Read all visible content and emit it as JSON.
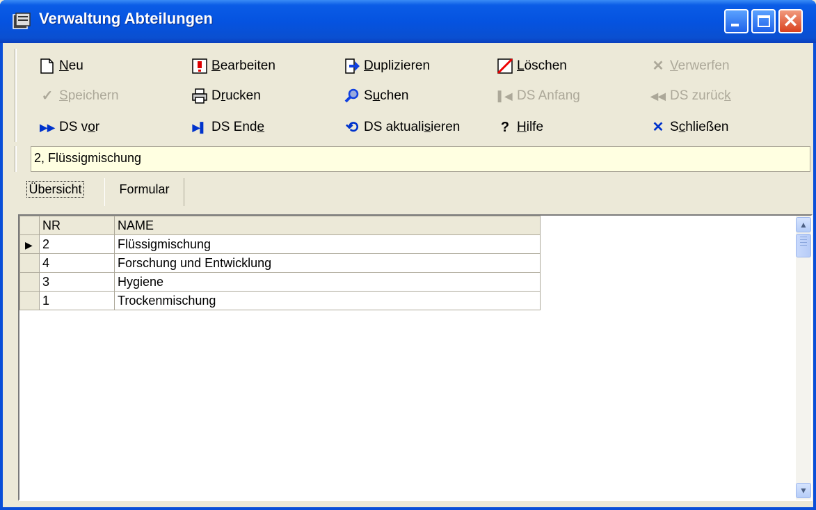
{
  "window": {
    "title": "Verwaltung Abteilungen"
  },
  "toolbar": {
    "neu": "Neu",
    "neu_u": "N",
    "neu_rest": "eu",
    "bearbeiten_u": "B",
    "bearbeiten_rest": "earbeiten",
    "duplizieren_u": "D",
    "duplizieren_rest": "uplizieren",
    "loeschen_u": "L",
    "loeschen_rest": "öschen",
    "verwerfen_u": "V",
    "verwerfen_rest": "erwerfen",
    "speichern_u": "S",
    "speichern_rest": "peichern",
    "drucken_a": "D",
    "drucken_u": "r",
    "drucken_b": "ucken",
    "suchen_a": "S",
    "suchen_u": "u",
    "suchen_b": "chen",
    "ds_anfang": "DS Anfang",
    "ds_zurueck_a": "DS zurüc",
    "ds_zurueck_u": "k",
    "ds_vor_a": "DS v",
    "ds_vor_u": "o",
    "ds_vor_b": "r",
    "ds_ende_a": "DS End",
    "ds_ende_u": "e",
    "ds_akt_a": "DS aktuali",
    "ds_akt_u": "s",
    "ds_akt_b": "ieren",
    "hilfe_u": "H",
    "hilfe_rest": "ilfe",
    "schliessen_a": "S",
    "schliessen_u": "c",
    "schliessen_b": "hließen"
  },
  "record_bar": {
    "value": "2, Flüssigmischung"
  },
  "tabs": [
    {
      "label": "Übersicht"
    },
    {
      "label": "Formular"
    }
  ],
  "grid": {
    "columns": [
      "NR",
      "NAME"
    ],
    "rows": [
      {
        "nr": "2",
        "name": "Flüssigmischung",
        "current": true
      },
      {
        "nr": "4",
        "name": "Forschung und Entwicklung",
        "current": false
      },
      {
        "nr": "3",
        "name": "Hygiene",
        "current": false
      },
      {
        "nr": "1",
        "name": "Trockenmischung",
        "current": false
      }
    ]
  },
  "icons": {
    "app": "app-icon",
    "new": "new-document-icon",
    "edit": "edit-icon",
    "duplicate": "duplicate-arrow-icon",
    "delete": "delete-icon",
    "discard": "discard-x-icon",
    "save": "save-check-icon",
    "print": "printer-icon",
    "search": "magnifier-icon",
    "first": "first-record-icon",
    "prev": "previous-record-icon",
    "next": "next-record-icon",
    "last": "last-record-icon",
    "refresh": "refresh-icon",
    "help": "help-icon",
    "close": "close-x-icon"
  },
  "colors": {
    "title_bar": "#0553e0",
    "record_bar_bg": "#ffffe1",
    "accent_icon": "#0033cc",
    "disabled_text": "#aca899"
  }
}
